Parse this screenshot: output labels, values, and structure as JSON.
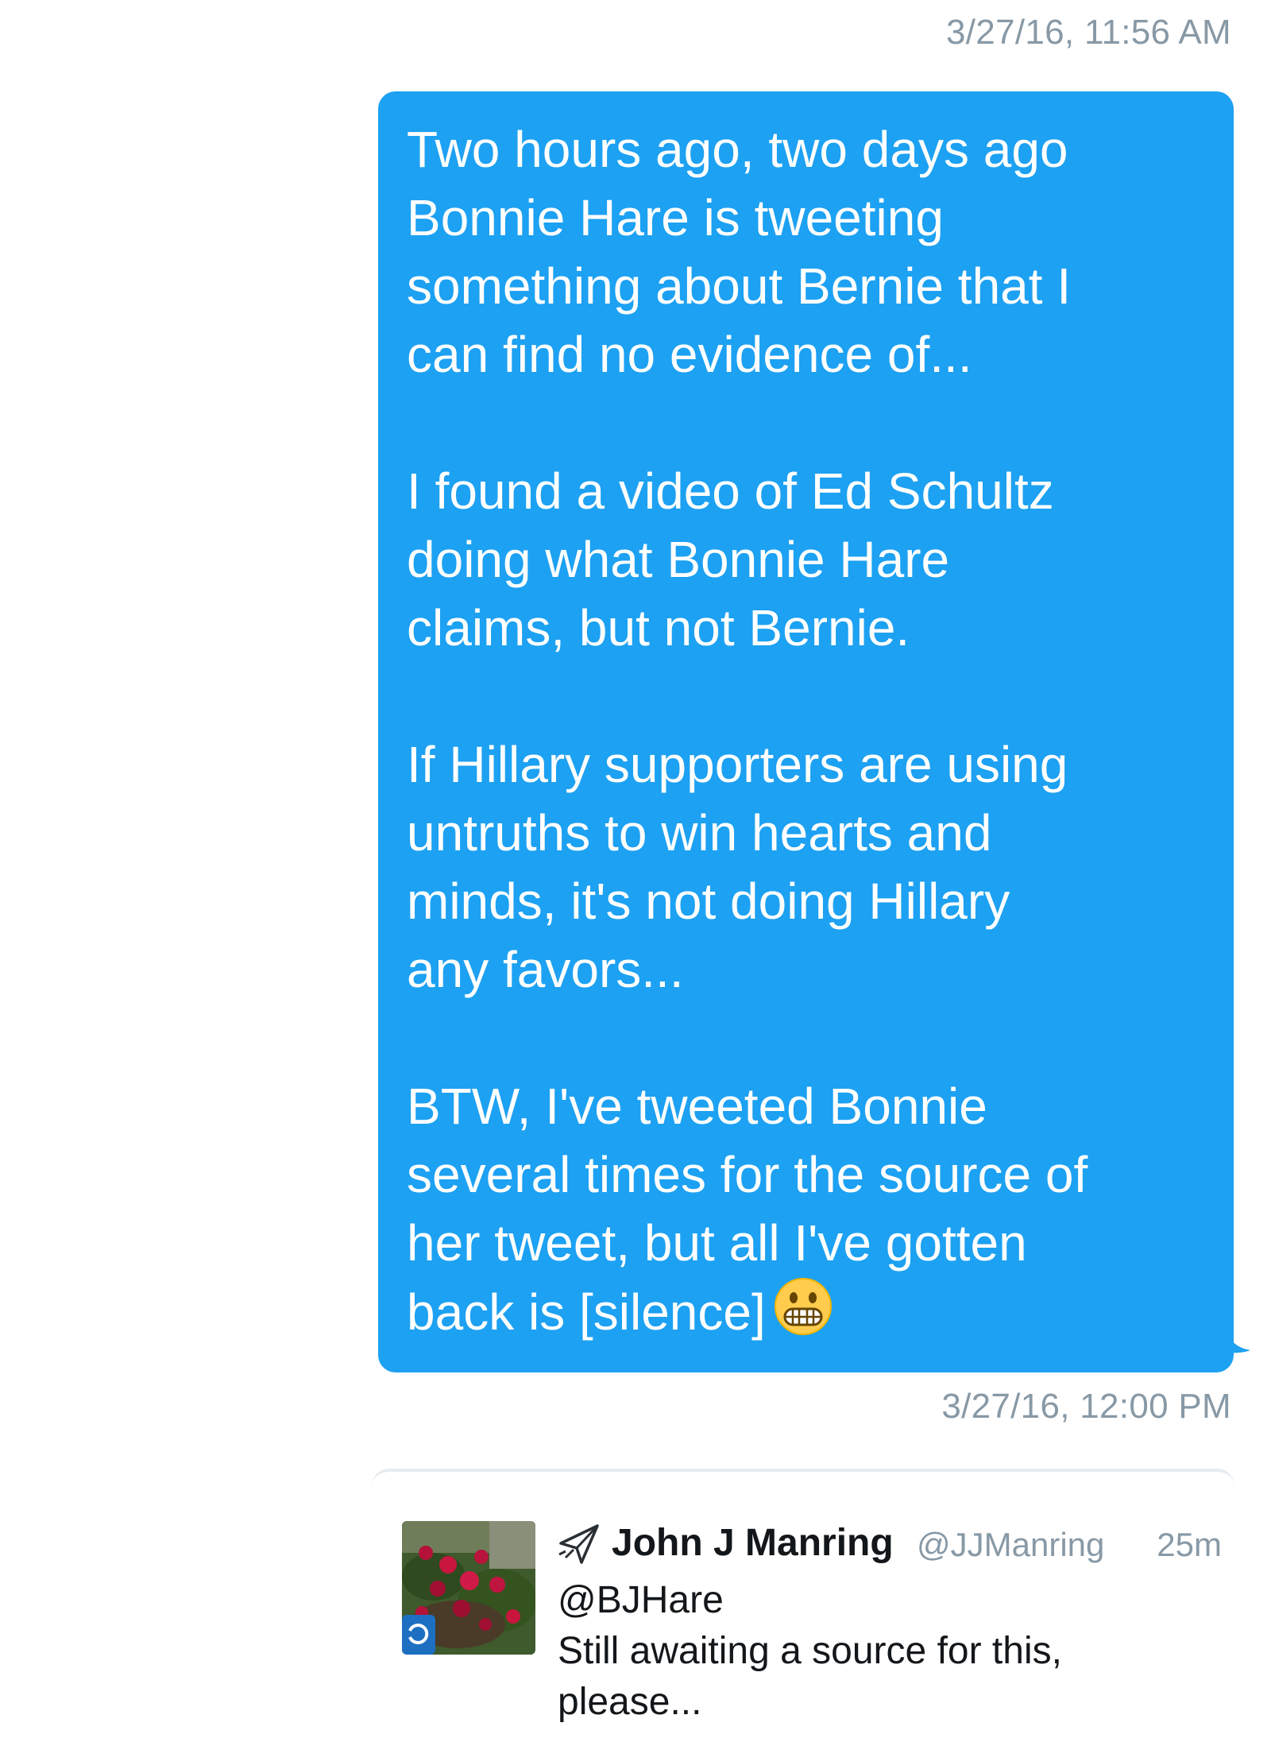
{
  "conversation": {
    "timestamp_first": "3/27/16, 11:56 AM",
    "timestamp_second": "3/27/16, 12:00 PM",
    "message": {
      "paragraph_1": "Two hours ago, two days ago\nBonnie Hare is tweeting\nsomething about Bernie that I\ncan find no evidence of...",
      "paragraph_2": "I found a video of Ed Schultz\ndoing what Bonnie Hare\nclaims, but not Bernie.",
      "paragraph_3": "If Hillary supporters are using\nuntruths to win hearts and\nminds, it's not doing Hillary\nany favors...",
      "paragraph_4": "BTW, I've tweeted Bonnie\nseveral times for the source of\nher tweet, but all I've gotten\nback is [silence]",
      "emoji": "grimacing-face-emoji",
      "bubble_color": "#1da1f2"
    },
    "shared_tweet": {
      "author_name": "John J Manring",
      "author_handle": "@JJManring",
      "time_ago": "25m",
      "mention": "@BJHare",
      "text_line_1": "Still awaiting a source for this,",
      "text_line_2": "please...",
      "avatar": "rose-bush-photo",
      "author_icon": "airplane-icon"
    }
  }
}
